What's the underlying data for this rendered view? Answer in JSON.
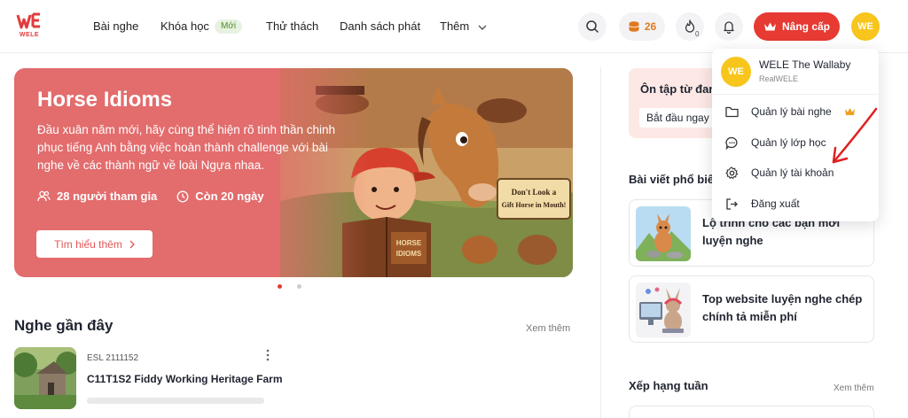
{
  "app": {
    "logo_text": "WELE"
  },
  "nav": {
    "listening": "Bài nghe",
    "courses": "Khóa học",
    "courses_badge": "Mới",
    "challenges": "Thử thách",
    "playlists": "Danh sách phát",
    "more": "Thêm"
  },
  "header": {
    "coins": "26",
    "streak": "0",
    "upgrade_label": "Nâng cấp",
    "avatar_initials": "WE"
  },
  "banner": {
    "title": "Horse Idioms",
    "description": "Đầu xuân năm mới, hãy cùng thể hiện rõ tinh thần chinh phục tiếng Anh bằng việc hoàn thành challenge với bài nghe về các thành ngữ về loài Ngựa nhaa.",
    "participants": "28 người tham gia",
    "remaining": "Còn 20 ngày",
    "cta": "Tìm hiểu thêm",
    "art_sign": "Don't Look a Gift Horse in Mouth!",
    "art_book": "HORSE IDIOMS"
  },
  "recent": {
    "title": "Nghe gần đây",
    "more": "Xem thêm",
    "items": [
      {
        "code": "ESL 2111152",
        "name": "C11T1S2 Fiddy Working Heritage Farm"
      }
    ]
  },
  "right": {
    "review_title": "Ôn tập từ đan",
    "review_button": "Bắt đầu ngay",
    "posts_title": "Bài viết phổ biế",
    "posts": [
      {
        "title": "Lộ trình cho các bạn mới luyện nghe"
      },
      {
        "title": "Top website luyện nghe chép chính tả miễn phí"
      }
    ],
    "rank_title": "Xếp hạng tuần",
    "rank_more": "Xem thêm"
  },
  "dropdown": {
    "avatar_initials": "WE",
    "name": "WELE The Wallaby",
    "username": "RealWELE",
    "items": [
      {
        "label": "Quản lý bài nghe",
        "icon": "folder-icon"
      },
      {
        "label": "Quản lý lớp học",
        "icon": "chat-bubble-icon"
      },
      {
        "label": "Quản lý tài khoản",
        "icon": "gear-icon"
      },
      {
        "label": "Đăng xuất",
        "icon": "logout-icon"
      }
    ]
  },
  "colors": {
    "accent": "#e63a33",
    "banner": "#e36c6d",
    "avatar": "#f7c51b",
    "coin": "#e07a1f"
  }
}
